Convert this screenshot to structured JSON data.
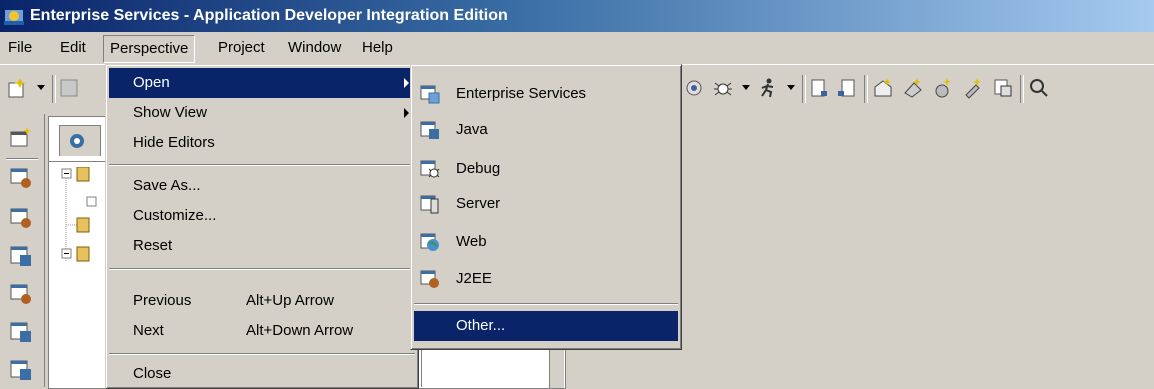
{
  "window": {
    "title": "Enterprise Services - Application Developer Integration Edition"
  },
  "menubar": {
    "items": [
      "File",
      "Edit",
      "Perspective",
      "Project",
      "Window",
      "Help"
    ]
  },
  "perspective_menu": {
    "items": [
      {
        "label": "Open",
        "accel": "",
        "submenu": true
      },
      {
        "label": "Show View",
        "accel": "",
        "submenu": true
      },
      {
        "label": "Hide Editors",
        "accel": ""
      },
      {
        "label": "Save As...",
        "accel": ""
      },
      {
        "label": "Customize...",
        "accel": ""
      },
      {
        "label": "Reset",
        "accel": ""
      },
      {
        "label": "Previous",
        "accel": "Alt+Up Arrow"
      },
      {
        "label": "Next",
        "accel": "Alt+Down Arrow"
      },
      {
        "label": "Close",
        "accel": ""
      }
    ]
  },
  "open_submenu": {
    "items": [
      {
        "label": "Enterprise Services",
        "icon": "enterprise-services-perspective-icon"
      },
      {
        "label": "Java",
        "icon": "java-perspective-icon"
      },
      {
        "label": "Debug",
        "icon": "debug-perspective-icon"
      },
      {
        "label": "Server",
        "icon": "server-perspective-icon"
      },
      {
        "label": "Web",
        "icon": "web-perspective-icon"
      },
      {
        "label": "J2EE",
        "icon": "j2ee-perspective-icon"
      },
      {
        "label": "Other...",
        "icon": ""
      }
    ]
  },
  "colors": {
    "title_start": "#0a246a",
    "title_end": "#a6caf0",
    "highlight": "#0a246a",
    "chrome": "#d4d0c8"
  }
}
